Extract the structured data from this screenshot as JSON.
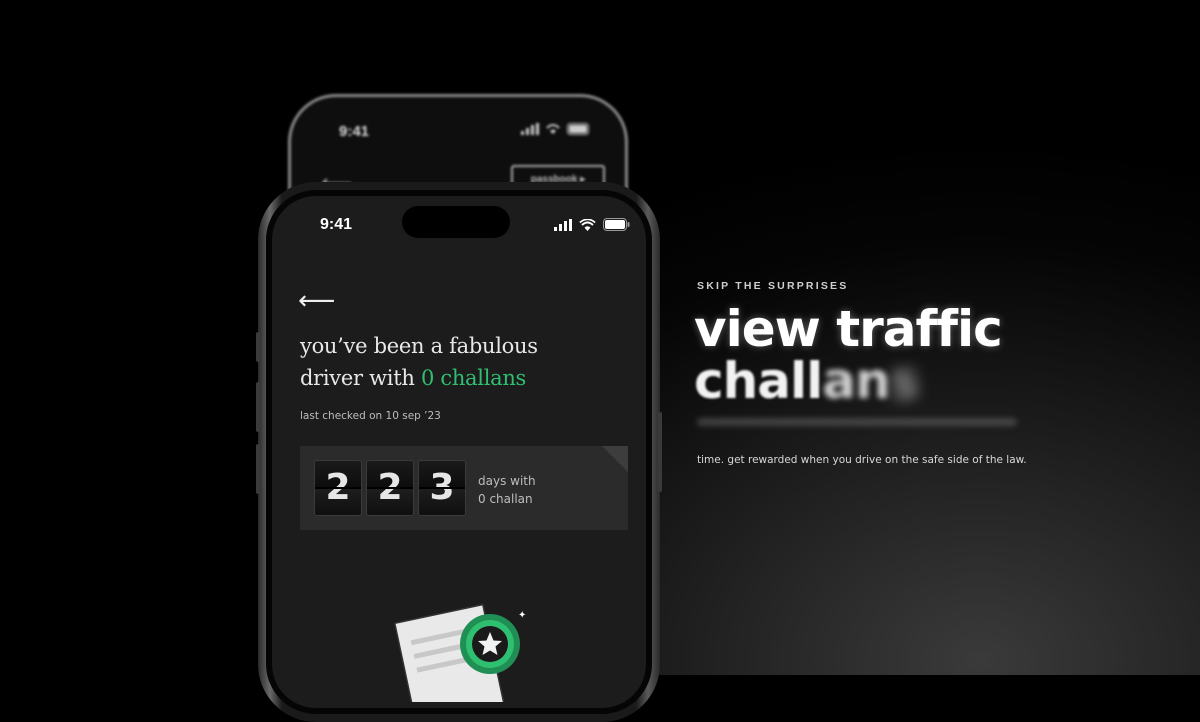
{
  "back_phone": {
    "time": "9:41",
    "chip_label": "passbook ▸"
  },
  "phone": {
    "time": "9:41",
    "headline_line1": "you’ve been a fabulous",
    "headline_prefix": "driver with ",
    "headline_highlight": "0 challans",
    "last_checked": "last checked on 10 sep ’23",
    "digits": [
      "2",
      "2",
      "3"
    ],
    "days_line1": "days with",
    "days_line2": "0 challan"
  },
  "hero": {
    "eyebrow": "SKIP THE SURPRISES",
    "title_line1": "view traffic",
    "title_line2_a": "chall",
    "title_line2_b": "an",
    "title_line2_c": "s",
    "description": "time. get rewarded when you drive on the safe side of the law."
  },
  "colors": {
    "accent": "#2fbf71",
    "background": "#000000"
  },
  "icons": [
    "back-arrow-icon",
    "signal-icon",
    "wifi-icon",
    "battery-icon",
    "star-badge-icon",
    "document-icon"
  ]
}
